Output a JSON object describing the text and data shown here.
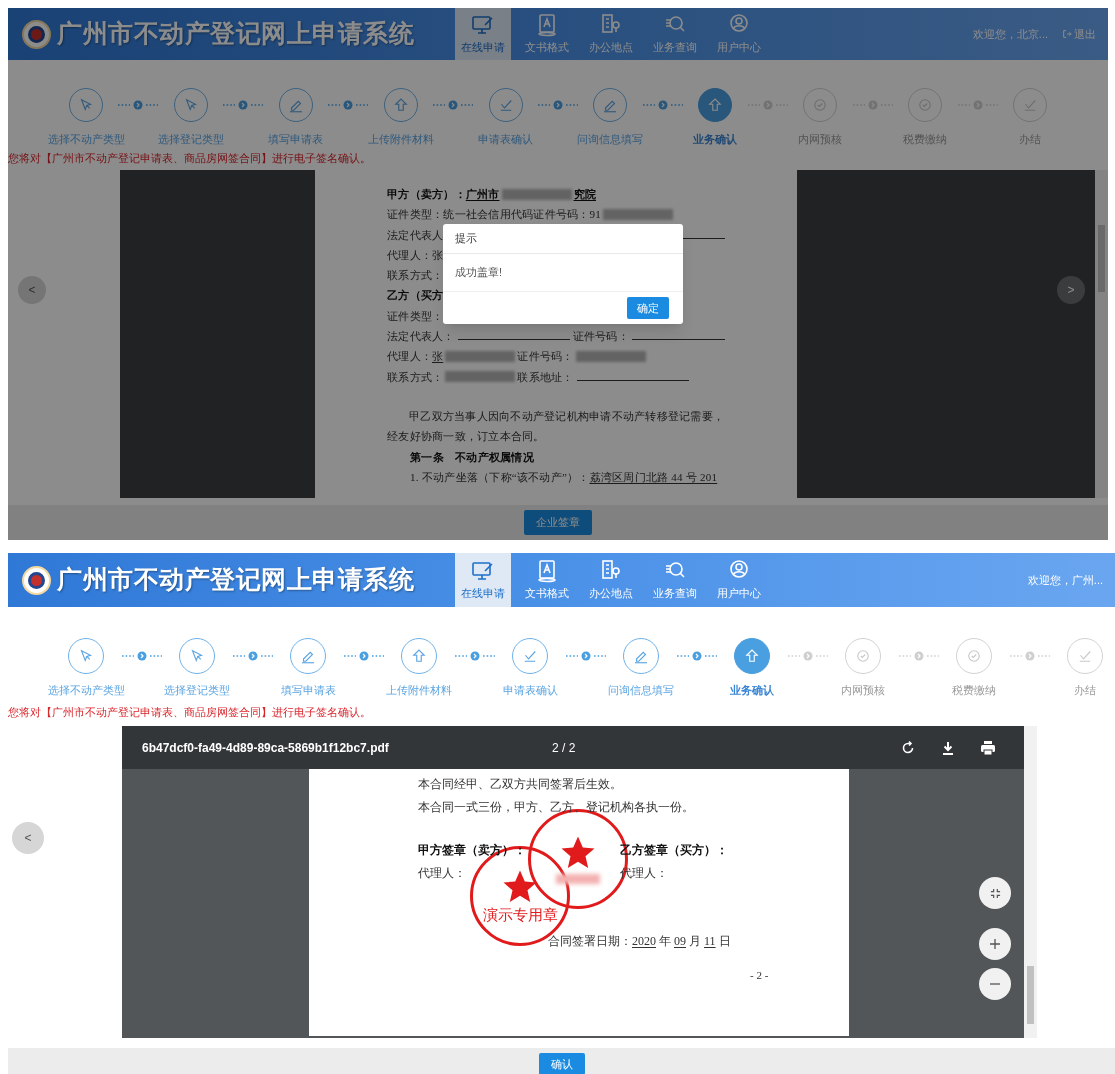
{
  "panels": [
    {
      "header": {
        "title": "广州市不动产登记网上申请系统",
        "nav": [
          {
            "label": "在线申请",
            "selected": true
          },
          {
            "label": "文书格式",
            "selected": false
          },
          {
            "label": "办公地点",
            "selected": false
          },
          {
            "label": "业务查询",
            "selected": false
          },
          {
            "label": "用户中心",
            "selected": false
          }
        ],
        "welcome": "欢迎您，北京...",
        "logout": "退出"
      },
      "steps": [
        {
          "label": "选择不动产类型",
          "completed": true,
          "selected": false
        },
        {
          "label": "选择登记类型",
          "completed": true,
          "selected": false
        },
        {
          "label": "填写申请表",
          "completed": true,
          "selected": false
        },
        {
          "label": "上传附件材料",
          "completed": true,
          "selected": false
        },
        {
          "label": "申请表确认",
          "completed": true,
          "selected": false
        },
        {
          "label": "问询信息填写",
          "completed": true,
          "selected": false
        },
        {
          "label": "业务确认",
          "completed": false,
          "selected": true
        },
        {
          "label": "内网预核",
          "completed": false,
          "selected": false
        },
        {
          "label": "税费缴纳",
          "completed": false,
          "selected": false
        },
        {
          "label": "办结",
          "completed": false,
          "selected": false
        }
      ],
      "notice": "您将对【广州市不动产登记申请表、商品房网签合同】进行电子签名确认。",
      "viewer": {
        "kind": "document",
        "prev": "<",
        "next": ">",
        "lines": [
          {
            "kind": "bold",
            "segments": [
              {
                "kind": "text",
                "text": "甲方（卖方）："
              },
              {
                "kind": "underlined",
                "text": "广州市"
              },
              {
                "kind": "redacted"
              },
              {
                "kind": "underlined",
                "text": "究院"
              }
            ]
          },
          {
            "kind": "plain",
            "segments": [
              {
                "kind": "text",
                "text": "证件类型："
              },
              {
                "kind": "text",
                "text": "统一社会信用代码证件号码：91"
              },
              {
                "kind": "redacted"
              }
            ]
          },
          {
            "kind": "plain",
            "segments": [
              {
                "kind": "text",
                "text": "法定代表人"
              },
              {
                "kind": "fill"
              }
            ]
          },
          {
            "kind": "plain",
            "segments": [
              {
                "kind": "text",
                "text": "代理人：张"
              }
            ]
          },
          {
            "kind": "plain",
            "segments": [
              {
                "kind": "text",
                "text": "联系方式："
              }
            ]
          },
          {
            "kind": "bold",
            "segments": [
              {
                "kind": "text",
                "text": "乙方（买方"
              }
            ]
          },
          {
            "kind": "plain",
            "segments": [
              {
                "kind": "text",
                "text": "证件类型："
              }
            ]
          },
          {
            "kind": "plain",
            "segments": [
              {
                "kind": "text",
                "text": "法定代表人："
              },
              {
                "kind": "blank"
              },
              {
                "kind": "text",
                "text": "证件号码："
              },
              {
                "kind": "fill"
              }
            ]
          },
          {
            "kind": "plain",
            "segments": [
              {
                "kind": "text",
                "text": "代理人："
              },
              {
                "kind": "underlined",
                "text": "张"
              },
              {
                "kind": "redacted"
              },
              {
                "kind": "text",
                "text": "证件号码："
              },
              {
                "kind": "redacted"
              }
            ]
          },
          {
            "kind": "plain",
            "segments": [
              {
                "kind": "text",
                "text": "联系方式："
              },
              {
                "kind": "redacted"
              },
              {
                "kind": "text",
                "text": "联系地址："
              },
              {
                "kind": "blank"
              }
            ]
          },
          {
            "kind": "paragraph",
            "segments": [
              {
                "kind": "text",
                "text": "甲乙双方当事人因向不动产登记机构申请不动产转移登记需要，经友好协商一致，订立本合同。"
              }
            ]
          },
          {
            "kind": "heading",
            "segments": [
              {
                "kind": "text",
                "text": "第一条　不动产权属情况"
              }
            ]
          },
          {
            "kind": "item",
            "segments": [
              {
                "kind": "text",
                "text": "1. 不动产坐落（下称“该不动产”）："
              },
              {
                "kind": "underlined",
                "text": "荔湾区周门北路 44 号 201"
              }
            ]
          }
        ]
      },
      "footer_button": "企业签章",
      "dialog": {
        "title": "提示",
        "message": "成功盖章!",
        "button": "确定"
      }
    },
    {
      "header": {
        "title": "广州市不动产登记网上申请系统",
        "nav": [
          {
            "label": "在线申请",
            "selected": true
          },
          {
            "label": "文书格式",
            "selected": false
          },
          {
            "label": "办公地点",
            "selected": false
          },
          {
            "label": "业务查询",
            "selected": false
          },
          {
            "label": "用户中心",
            "selected": false
          }
        ],
        "welcome": "欢迎您，广州..."
      },
      "steps": [
        {
          "label": "选择不动产类型",
          "completed": true,
          "selected": false
        },
        {
          "label": "选择登记类型",
          "completed": true,
          "selected": false
        },
        {
          "label": "填写申请表",
          "completed": true,
          "selected": false
        },
        {
          "label": "上传附件材料",
          "completed": true,
          "selected": false
        },
        {
          "label": "申请表确认",
          "completed": true,
          "selected": false
        },
        {
          "label": "问询信息填写",
          "completed": true,
          "selected": false
        },
        {
          "label": "业务确认",
          "completed": false,
          "selected": true
        },
        {
          "label": "内网预核",
          "completed": false,
          "selected": false
        },
        {
          "label": "税费缴纳",
          "completed": false,
          "selected": false
        },
        {
          "label": "办结",
          "completed": false,
          "selected": false
        }
      ],
      "notice": "您将对【广州市不动产登记申请表、商品房网签合同】进行电子签名确认。",
      "viewer": {
        "kind": "pdf",
        "prev": "<",
        "filename": "6b47dcf0-fa49-4d89-89ca-5869b1f12bc7.pdf",
        "page": "2 / 2",
        "lines": [
          {
            "kind": "plain",
            "segments": [
              {
                "kind": "text",
                "text": "本合同经甲、乙双方共同签署后生效。"
              }
            ]
          },
          {
            "kind": "plain",
            "segments": [
              {
                "kind": "text",
                "text": "本合同一式三份，甲方、乙方、登记机构各执一份。"
              }
            ]
          }
        ],
        "signatures": [
          {
            "title": "甲方签章（卖方）：",
            "agent": "代理人："
          },
          {
            "title": "乙方签章（买方）：",
            "agent": "代理人："
          }
        ],
        "date": [
          {
            "kind": "text",
            "text": "合同签署日期："
          },
          {
            "kind": "underlined",
            "text": "2020"
          },
          {
            "kind": "text",
            "text": " 年 "
          },
          {
            "kind": "underlined",
            "text": "09"
          },
          {
            "kind": "text",
            "text": " 月 "
          },
          {
            "kind": "underlined",
            "text": "11"
          },
          {
            "kind": "text",
            "text": " 日"
          }
        ],
        "page_number": "- 2 -",
        "seals": [
          {
            "kind": "labeled",
            "label": "演示专用章"
          },
          {
            "kind": "blurred"
          }
        ]
      },
      "footer_button": "确认"
    }
  ]
}
